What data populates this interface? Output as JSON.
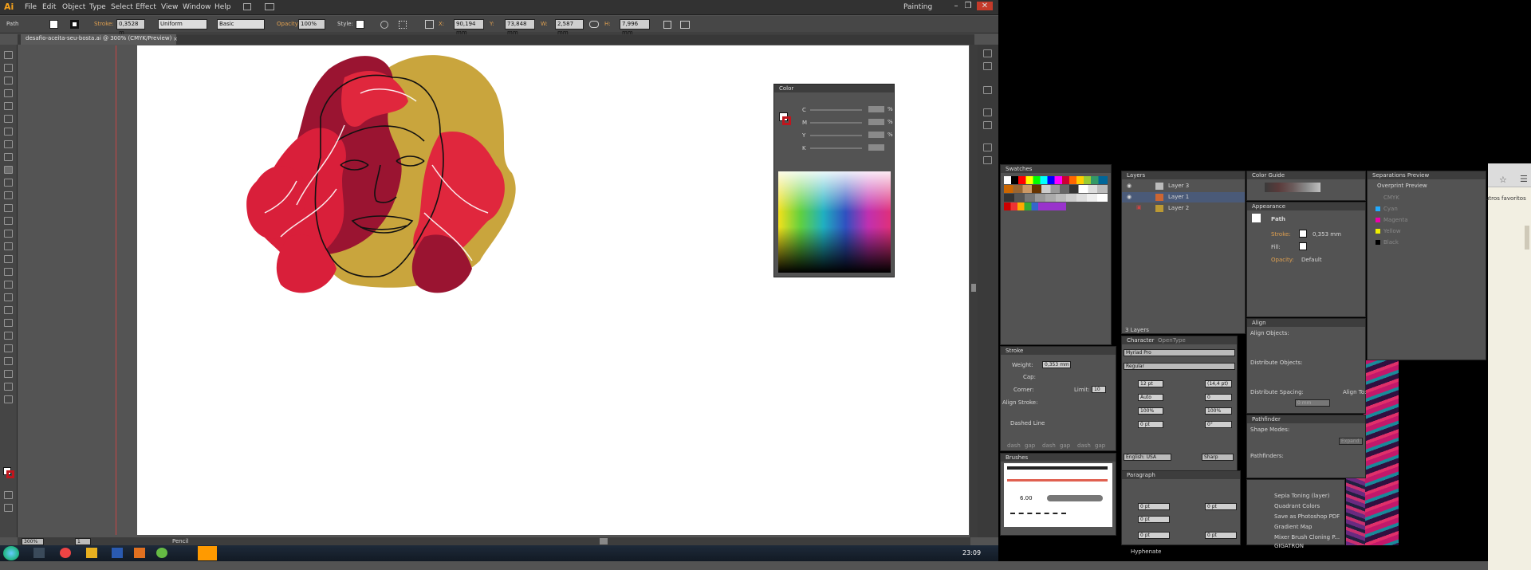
{
  "app": {
    "logo": "Ai",
    "workspace": "Painting"
  },
  "menu": [
    "File",
    "Edit",
    "Object",
    "Type",
    "Select",
    "Effect",
    "View",
    "Window",
    "Help"
  ],
  "control": {
    "selection": "Path",
    "stroke_label": "Stroke:",
    "stroke_value": "0,3528 m",
    "uniform": "Uniform",
    "basic": "Basic",
    "opacity_label": "Opacity:",
    "opacity_value": "100%",
    "style_label": "Style:",
    "x_label": "X:",
    "x_value": "90,194 mm",
    "y_label": "Y:",
    "y_value": "73,848 mm",
    "w_label": "W:",
    "w_value": "2,587 mm",
    "h_label": "H:",
    "h_value": "7,996 mm"
  },
  "doc_tab": "desafio-aceita-seu-bosta.ai @ 300% (CMYK/Preview)",
  "status": {
    "zoom": "300%",
    "page": "1",
    "tool": "Pencil"
  },
  "color_panel": {
    "title": "Color",
    "channels": [
      "C",
      "M",
      "Y",
      "K"
    ],
    "pct": "%"
  },
  "swatches_panel": {
    "title": "Swatches"
  },
  "layers_panel": {
    "title": "Layers",
    "layers": [
      "Layer 3",
      "Layer 1",
      "Layer 2"
    ],
    "footer": "3 Layers"
  },
  "color_guide": {
    "title": "Color Guide"
  },
  "appearance": {
    "title": "Appearance",
    "object": "Path",
    "stroke_label": "Stroke:",
    "stroke_value": "0,353 mm",
    "fill_label": "Fill:",
    "opacity_label": "Opacity:",
    "opacity_value": "Default"
  },
  "separations": {
    "title": "Separations Preview",
    "overprint": "Overprint Preview",
    "inks": [
      "CMYK",
      "Cyan",
      "Magenta",
      "Yellow",
      "Black"
    ]
  },
  "stroke_panel": {
    "title": "Stroke",
    "weight_label": "Weight:",
    "weight_value": "0,353 mm",
    "cap_label": "Cap:",
    "corner_label": "Corner:",
    "limit_label": "Limit:",
    "limit_value": "10",
    "align_label": "Align Stroke:",
    "dashed": "Dashed Line",
    "dash_labels": [
      "dash",
      "gap",
      "dash",
      "gap",
      "dash",
      "gap"
    ]
  },
  "character": {
    "title": "Character",
    "tab2": "OpenType",
    "font": "Myriad Pro",
    "style": "Regular",
    "size": "12 pt",
    "leading": "(14,4 pt)",
    "kerning": "Auto",
    "tracking": "0",
    "vscale": "100%",
    "hscale": "100%",
    "baseline": "0 pt",
    "rotation": "0°",
    "language": "English: USA",
    "aa": "Sharp"
  },
  "align": {
    "title": "Align",
    "objects": "Align Objects:",
    "distribute": "Distribute Objects:",
    "spacing": "Distribute Spacing:",
    "align_to": "Align To:",
    "spacing_value": "0 mm"
  },
  "pathfinder": {
    "title": "Pathfinder",
    "shape_modes": "Shape Modes:",
    "pathfinders": "Pathfinders:",
    "expand": "Expand"
  },
  "brushes": {
    "title": "Brushes",
    "size": "6.00"
  },
  "paragraph": {
    "title": "Paragraph",
    "v1": "0 pt",
    "v2": "0 pt",
    "v3": "0 pt",
    "v4": "0 pt",
    "v5": "0 pt",
    "hyphenate": "Hyphenate"
  },
  "actions": [
    "Sepia Toning (layer)",
    "Quadrant Colors",
    "Save as Photoshop PDF",
    "Gradient Map",
    "Mixer Brush Cloning P...",
    "GIGATRON"
  ],
  "browser": {
    "text": "utros favoritos"
  },
  "taskbar": {
    "time": "23:09"
  }
}
